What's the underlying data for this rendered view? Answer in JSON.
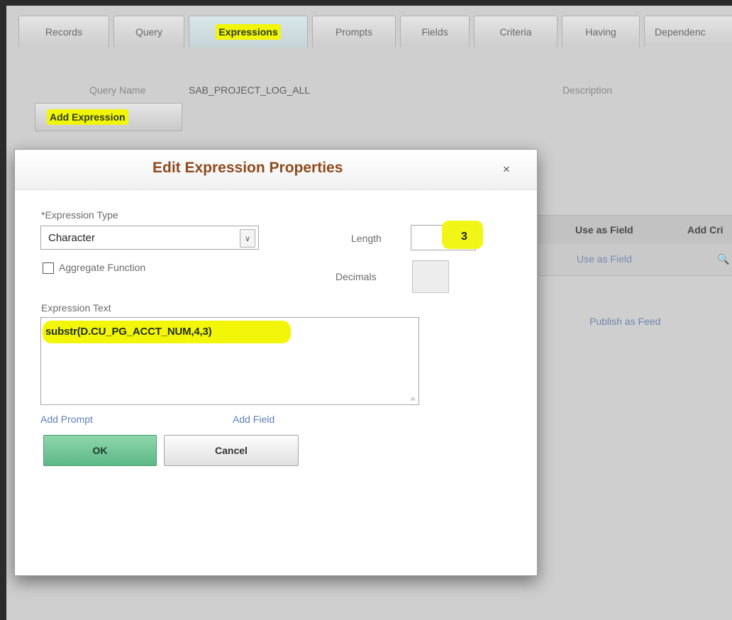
{
  "tabs": [
    "Records",
    "Query",
    "Expressions",
    "Prompts",
    "Fields",
    "Criteria",
    "Having",
    "Dependenc"
  ],
  "query": {
    "name_label": "Query Name",
    "name_value": "SAB_PROJECT_LOG_ALL",
    "description_label": "Description"
  },
  "add_expression_button": "Add Expression",
  "grid": {
    "headers": [
      "Use as Field",
      "Add Cri"
    ],
    "row": [
      "Use as Field",
      "🔍"
    ],
    "publish_link": "Publish as Feed"
  },
  "dialog": {
    "title": "Edit Expression Properties",
    "close_glyph": "×",
    "expression_type_label": "*Expression Type",
    "expression_type_value": "Character",
    "aggregate_label": "Aggregate Function",
    "aggregate_checked": false,
    "length_label": "Length",
    "length_value": "3",
    "decimals_label": "Decimals",
    "decimals_value": "",
    "expression_text_label": "Expression Text",
    "expression_text_value": "substr(D.CU_PG_ACCT_NUM,4,3)",
    "add_prompt_link": "Add Prompt",
    "add_field_link": "Add Field",
    "ok_button": "OK",
    "cancel_button": "Cancel"
  },
  "colors": {
    "highlight": "#f1f50a",
    "title": "#8e4a1c",
    "link": "#5d7fb8",
    "ok_button": "#6cc492"
  }
}
